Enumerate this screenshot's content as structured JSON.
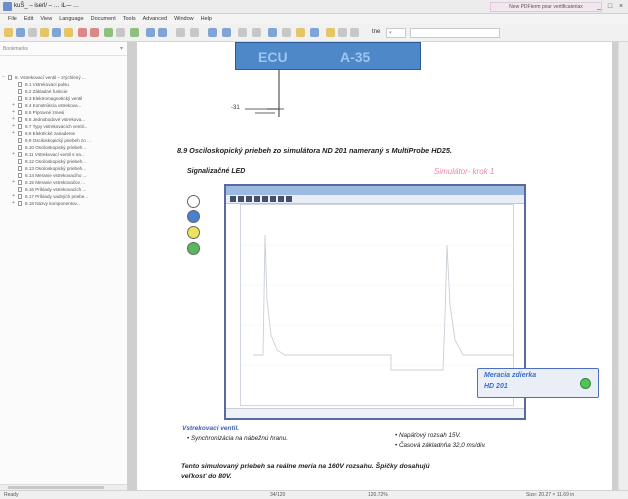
{
  "window": {
    "title": "kuŠ_ – iserl/ – … iL-– …",
    "notice": "New PDFterm pour vertificateriax"
  },
  "menu": [
    "File",
    "Edit",
    "View",
    "Language",
    "Document",
    "Tools",
    "Advanced",
    "Window",
    "Help"
  ],
  "toolbar": {
    "zoom_label": "tne",
    "search_placeholder": "",
    "marker": "H"
  },
  "sidebar": {
    "panel_title": "Bookmarks",
    "items": [
      {
        "label": "8. Vstrekovací ventil – zrýchlený ...",
        "indent": 0,
        "exp": "−"
      },
      {
        "label": "8.1 Vstrekovací pulsu",
        "indent": 1,
        "exp": ""
      },
      {
        "label": "8.2 Základné funkcie",
        "indent": 1,
        "exp": ""
      },
      {
        "label": "8.3 Elektromagnetický ventil",
        "indent": 1,
        "exp": ""
      },
      {
        "label": "8.4 Konstrúkcia vstrekova...",
        "indent": 1,
        "exp": "+"
      },
      {
        "label": "8.5 Pípravné zmesi",
        "indent": 1,
        "exp": "+"
      },
      {
        "label": "8.6 Jednobodové vstrekova...",
        "indent": 1,
        "exp": "+"
      },
      {
        "label": "8.7 Typy vstrekovacích ventil...",
        "indent": 1,
        "exp": "+"
      },
      {
        "label": "8.8 Elektrické zariadenie",
        "indent": 1,
        "exp": "+"
      },
      {
        "label": "8.9 Osciloskopický priebeh zo ...",
        "indent": 1,
        "exp": ""
      },
      {
        "label": "8.10 Osciloskopický priebeh...",
        "indent": 1,
        "exp": ""
      },
      {
        "label": "8.11 Vstrekovací ventil s na...",
        "indent": 1,
        "exp": "+"
      },
      {
        "label": "8.12 Osciloskopický priebeh...",
        "indent": 1,
        "exp": ""
      },
      {
        "label": "8.13 Osciloskopický priebeh...",
        "indent": 1,
        "exp": ""
      },
      {
        "label": "8.14 Meranie vstrekovacího ...",
        "indent": 1,
        "exp": ""
      },
      {
        "label": "8.15 Meranie vstrekovačov ...",
        "indent": 1,
        "exp": "+"
      },
      {
        "label": "8.16 Príklady vstrekovacích ...",
        "indent": 1,
        "exp": ""
      },
      {
        "label": "8.17 Príklady vadných priebe...",
        "indent": 1,
        "exp": "+"
      },
      {
        "label": "8.18 Názvy komponentov...",
        "indent": 1,
        "exp": "+"
      }
    ]
  },
  "document": {
    "banner_left": "ECU",
    "banner_right": "A-35",
    "axis_value": "-31",
    "section_heading": "8.9 Osciloskopický priebeh zo simulátora ND 201 nameraný s MultiProbe HD25.",
    "signal_label": "Signalizačné LED",
    "simulator_label": "Simulátor- krok 1",
    "led_colors": [
      "#ffffff",
      "#4a80d0",
      "#f0e060",
      "#58b85a"
    ],
    "measurement_box": {
      "line1": "Meracia zdierka",
      "line2": "HD 201"
    },
    "note_title": "Vstrekovací ventil.",
    "notes_left": [
      "Synchronizácia na nábežnú hranu."
    ],
    "notes_right": [
      "Napäťový rozsah 15V.",
      "Časová základnňa 32,0 ms/div."
    ],
    "closing_line1": "Tento simulovaný priebeh sa reálne meria na 160V rozsahu. Špičky dosahujú",
    "closing_line2": "veľkosť do 80V."
  },
  "status": {
    "left": "Ready",
    "page": "34/120",
    "zoom": "120.72%",
    "size": "Size: 20.27 × 11.69 in"
  }
}
